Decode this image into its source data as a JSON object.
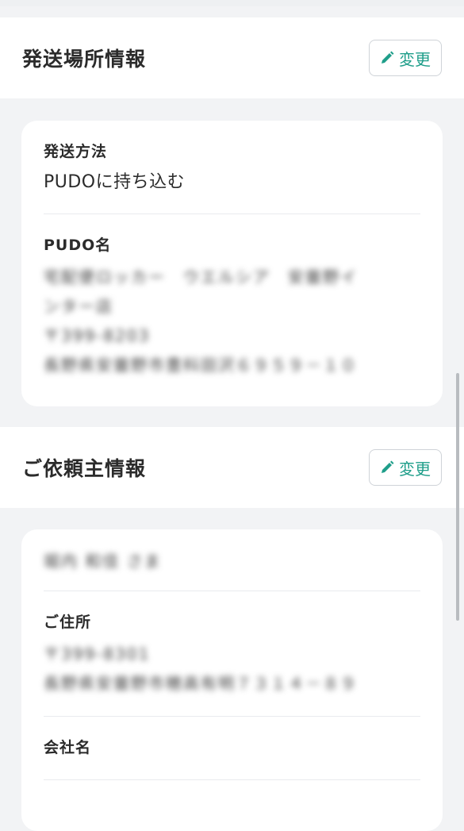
{
  "shipping": {
    "title": "発送場所情報",
    "edit_label": "変更",
    "method_label": "発送方法",
    "method_value": "PUDOに持ち込む",
    "pudo_label": "PUDO名",
    "pudo_lines": [
      "宅配便ロッカー　ウエルシア　安曇野イ",
      "ンター店",
      "〒399-8203",
      "長野県安曇野市豊科田沢６９５９－１０"
    ]
  },
  "requester": {
    "title": "ご依頼主情報",
    "edit_label": "変更",
    "name": "堀内 和佳 さま",
    "address_label": "ご住所",
    "address_lines": [
      "〒399-8301",
      "長野県安曇野市穂高有明７３１４－８９"
    ],
    "company_label": "会社名"
  },
  "colors": {
    "accent": "#1f9e8a",
    "background": "#f2f3f5"
  },
  "icons": {
    "edit": "pencil-icon"
  }
}
